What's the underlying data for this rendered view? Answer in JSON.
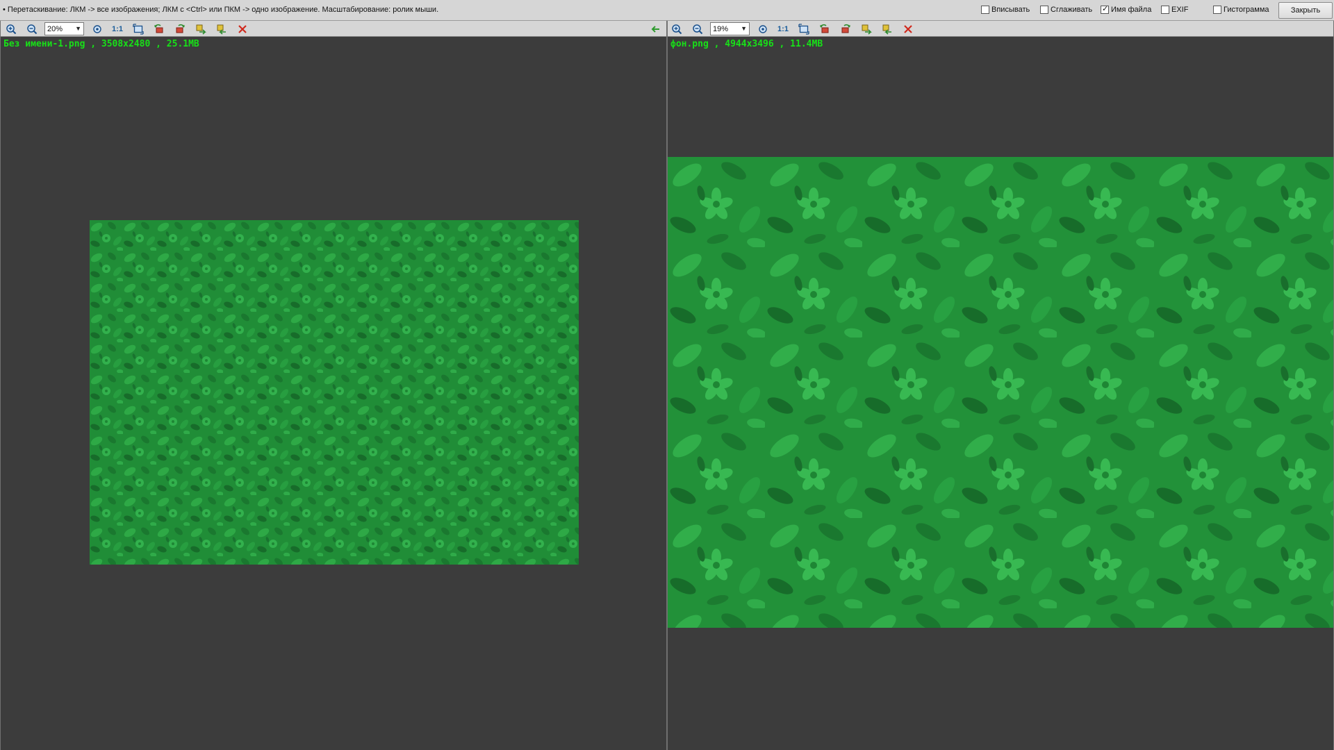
{
  "top_bar": {
    "hint": "• Перетаскивание: ЛКМ -> все изображения; ЛКМ с <Ctrl> или ПКМ -> одно изображение. Масштабирование: ролик мыши.",
    "options": [
      {
        "label": "Вписывать",
        "checked": false
      },
      {
        "label": "Сглаживать",
        "checked": false
      },
      {
        "label": "Имя файла",
        "checked": true
      },
      {
        "label": "EXIF",
        "checked": false
      },
      {
        "label": "Гистограмма",
        "checked": false
      }
    ],
    "close_label": "Закрыть"
  },
  "left_pane": {
    "zoom": "20%",
    "one_to_one": "1:1",
    "file_info": "Без имени-1.png , 3508x2480 , 25.1MB"
  },
  "right_pane": {
    "zoom": "19%",
    "one_to_one": "1:1",
    "file_info": "фон.png , 4944x3496 , 11.4MB"
  },
  "icons": {
    "zoom_in": "zoom-in-icon",
    "zoom_out": "zoom-out-icon",
    "fit": "fit-icon",
    "crop": "fit-window-icon",
    "rotate_left": "rotate-left-icon",
    "rotate_right": "rotate-right-icon",
    "flip": "flip-icon",
    "swap": "swap-icon",
    "close": "close-icon",
    "sync": "sync-arrow-icon"
  },
  "colors": {
    "background": "#3c3c3c",
    "toolbar": "#d6d6d6",
    "file_info": "#18e018",
    "foliage_light": "#2fb24a",
    "foliage_dark": "#1a7a30"
  }
}
